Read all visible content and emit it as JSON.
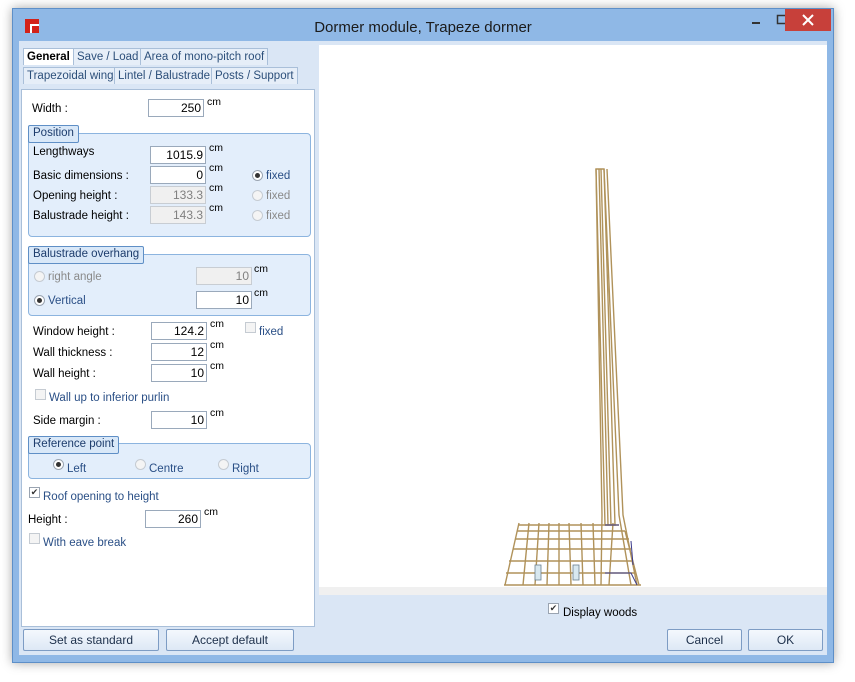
{
  "window": {
    "title": "Dormer module, Trapeze dormer"
  },
  "tabs": {
    "row1": [
      "General",
      "Save / Load",
      "Area of mono-pitch roof"
    ],
    "row2": [
      "Trapezoidal wing",
      "Lintel / Balustrade",
      "Posts / Support"
    ]
  },
  "width": {
    "label": "Width :",
    "value": "250",
    "unit": "cm"
  },
  "position": {
    "title": "Position",
    "lengthways": {
      "label": "Lengthways",
      "value": "1015.9",
      "unit": "cm"
    },
    "basic": {
      "label": "Basic dimensions :",
      "value": "0",
      "unit": "cm",
      "radio": "fixed"
    },
    "opening": {
      "label": "Opening height :",
      "value": "133.3",
      "unit": "cm",
      "radio": "fixed"
    },
    "balustrade": {
      "label": "Balustrade height :",
      "value": "143.3",
      "unit": "cm",
      "radio": "fixed"
    }
  },
  "overhang": {
    "title": "Balustrade overhang",
    "right_angle": {
      "label": "right angle",
      "value": "10",
      "unit": "cm"
    },
    "vertical": {
      "label": "Vertical",
      "value": "10",
      "unit": "cm"
    }
  },
  "window_height": {
    "label": "Window height :",
    "value": "124.2",
    "unit": "cm",
    "check": "fixed"
  },
  "wall_thickness": {
    "label": "Wall thickness :",
    "value": "12",
    "unit": "cm"
  },
  "wall_height": {
    "label": "Wall height :",
    "value": "10",
    "unit": "cm"
  },
  "wall_up": {
    "label": "Wall up to inferior purlin"
  },
  "side_margin": {
    "label": "Side margin :",
    "value": "10",
    "unit": "cm"
  },
  "reference": {
    "title": "Reference point",
    "left": "Left",
    "centre": "Centre",
    "right": "Right"
  },
  "roof_opening": {
    "label": "Roof opening to height"
  },
  "height": {
    "label": "Height :",
    "value": "260",
    "unit": "cm"
  },
  "eave_break": {
    "label": "With eave break"
  },
  "display_woods": {
    "label": "Display woods"
  },
  "buttons": {
    "set_standard": "Set as standard",
    "accept_default": "Accept default",
    "cancel": "Cancel",
    "ok": "OK"
  },
  "colors": {
    "wood": "#b0925a",
    "window_frame": "#8fb8e6",
    "accent": "#1d3c6c"
  },
  "icons": [
    "app-icon",
    "minimize-icon",
    "maximize-icon",
    "close-icon"
  ]
}
